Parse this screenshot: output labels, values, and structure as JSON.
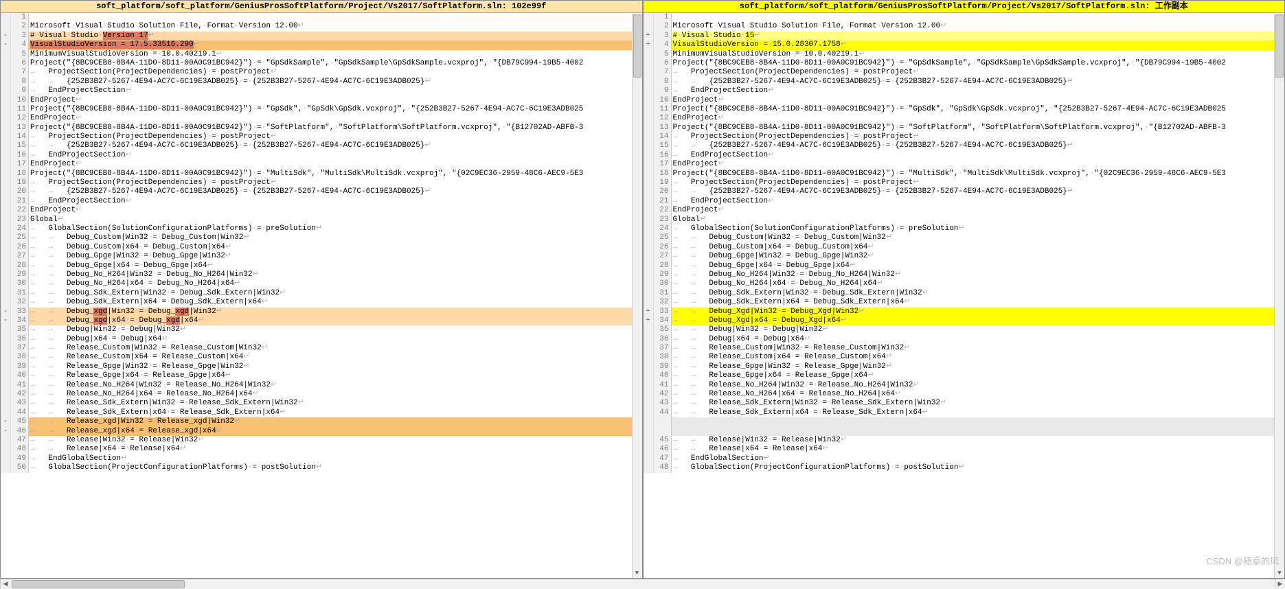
{
  "watermark": "CSDN @随意的风",
  "left": {
    "title": "soft_platform/soft_platform/GeniusProsSoftPlatform/Project/Vs2017/SoftPlatform.sln: 102e99f",
    "rows": [
      {
        "mk": "",
        "ln": "1",
        "text": "",
        "bg": ""
      },
      {
        "mk": "",
        "ln": "2",
        "text": "Microsoft·Visual·Studio·Solution·File,·Format·Version·12.00↩",
        "bg": ""
      },
      {
        "mk": "-",
        "ln": "3",
        "pre": "#·Visual·Studio·",
        "chip": "Version·17",
        "post": "↩",
        "bg": "bg-rm",
        "chipcls": "chip-rm"
      },
      {
        "mk": "-",
        "ln": "4",
        "pre": "",
        "chip": "VisualStudioVersion·=·17.5.33516.290",
        "post": "↩",
        "bg": "bg-rm-strong",
        "chipcls": "chip-rm"
      },
      {
        "mk": "",
        "ln": "5",
        "text": "MinimumVisualStudioVersion·=·10.0.40219.1↩",
        "bg": ""
      },
      {
        "mk": "",
        "ln": "6",
        "text": "Project(\"{8BC9CEB8-8B4A-11D0-8D11-00A0C91BC942}\")·=·\"GpSdkSample\",·\"GpSdkSample\\GpSdkSample.vcxproj\",·\"{DB79C994-19B5-4002",
        "bg": ""
      },
      {
        "mk": "",
        "ln": "7",
        "text": "→   ProjectSection(ProjectDependencies)·=·postProject↩",
        "bg": ""
      },
      {
        "mk": "",
        "ln": "8",
        "text": "→   →   {252B3B27-5267-4E94-AC7C-6C19E3ADB025}·=·{252B3B27-5267-4E94-AC7C-6C19E3ADB025}↩",
        "bg": ""
      },
      {
        "mk": "",
        "ln": "9",
        "text": "→   EndProjectSection↩",
        "bg": ""
      },
      {
        "mk": "",
        "ln": "10",
        "text": "EndProject↩",
        "bg": ""
      },
      {
        "mk": "",
        "ln": "11",
        "text": "Project(\"{8BC9CEB8-8B4A-11D0-8D11-00A0C91BC942}\")·=·\"GpSdk\",·\"GpSdk\\GpSdk.vcxproj\",·\"{252B3B27-5267-4E94-AC7C-6C19E3ADB025",
        "bg": ""
      },
      {
        "mk": "",
        "ln": "12",
        "text": "EndProject↩",
        "bg": ""
      },
      {
        "mk": "",
        "ln": "13",
        "text": "Project(\"{8BC9CEB8-8B4A-11D0-8D11-00A0C91BC942}\")·=·\"SoftPlatform\",·\"SoftPlatform\\SoftPlatform.vcxproj\",·\"{B12702AD-ABFB-3",
        "bg": ""
      },
      {
        "mk": "",
        "ln": "14",
        "text": "→   ProjectSection(ProjectDependencies)·=·postProject↩",
        "bg": ""
      },
      {
        "mk": "",
        "ln": "15",
        "text": "→   →   {252B3B27-5267-4E94-AC7C-6C19E3ADB025}·=·{252B3B27-5267-4E94-AC7C-6C19E3ADB025}↩",
        "bg": ""
      },
      {
        "mk": "",
        "ln": "16",
        "text": "→   EndProjectSection↩",
        "bg": ""
      },
      {
        "mk": "",
        "ln": "17",
        "text": "EndProject↩",
        "bg": ""
      },
      {
        "mk": "",
        "ln": "18",
        "text": "Project(\"{8BC9CEB8-8B4A-11D0-8D11-00A0C91BC942}\")·=·\"MultiSdk\",·\"MultiSdk\\MultiSdk.vcxproj\",·\"{02C9EC36-2959-48C6-AEC9-5E3",
        "bg": ""
      },
      {
        "mk": "",
        "ln": "19",
        "text": "→   ProjectSection(ProjectDependencies)·=·postProject↩",
        "bg": ""
      },
      {
        "mk": "",
        "ln": "20",
        "text": "→   →   {252B3B27-5267-4E94-AC7C-6C19E3ADB025}·=·{252B3B27-5267-4E94-AC7C-6C19E3ADB025}↩",
        "bg": ""
      },
      {
        "mk": "",
        "ln": "21",
        "text": "→   EndProjectSection↩",
        "bg": ""
      },
      {
        "mk": "",
        "ln": "22",
        "text": "EndProject↩",
        "bg": ""
      },
      {
        "mk": "",
        "ln": "23",
        "text": "Global↩",
        "bg": ""
      },
      {
        "mk": "",
        "ln": "24",
        "text": "→   GlobalSection(SolutionConfigurationPlatforms)·=·preSolution↩",
        "bg": ""
      },
      {
        "mk": "",
        "ln": "25",
        "text": "→   →   Debug_Custom|Win32·=·Debug_Custom|Win32↩",
        "bg": ""
      },
      {
        "mk": "",
        "ln": "26",
        "text": "→   →   Debug_Custom|x64·=·Debug_Custom|x64↩",
        "bg": ""
      },
      {
        "mk": "",
        "ln": "27",
        "text": "→   →   Debug_Gpge|Win32·=·Debug_Gpge|Win32↩",
        "bg": ""
      },
      {
        "mk": "",
        "ln": "28",
        "text": "→   →   Debug_Gpge|x64·=·Debug_Gpge|x64↩",
        "bg": ""
      },
      {
        "mk": "",
        "ln": "29",
        "text": "→   →   Debug_No_H264|Win32·=·Debug_No_H264|Win32↩",
        "bg": ""
      },
      {
        "mk": "",
        "ln": "30",
        "text": "→   →   Debug_No_H264|x64·=·Debug_No_H264|x64↩",
        "bg": ""
      },
      {
        "mk": "",
        "ln": "31",
        "text": "→   →   Debug_Sdk_Extern|Win32·=·Debug_Sdk_Extern|Win32↩",
        "bg": ""
      },
      {
        "mk": "",
        "ln": "32",
        "text": "→   →   Debug_Sdk_Extern|x64·=·Debug_Sdk_Extern|x64↩",
        "bg": ""
      },
      {
        "mk": "-",
        "ln": "33",
        "parts": [
          {
            "t": "→   →   Debug_"
          },
          {
            "t": "xgd",
            "c": "chip-rm"
          },
          {
            "t": "|Win32·=·Debug_"
          },
          {
            "t": "xgd",
            "c": "chip-rm"
          },
          {
            "t": "|Win32↩"
          }
        ],
        "bg": "bg-rm"
      },
      {
        "mk": "-",
        "ln": "34",
        "parts": [
          {
            "t": "→   →   Debug_"
          },
          {
            "t": "xgd",
            "c": "chip-rm"
          },
          {
            "t": "|x64·=·Debug_"
          },
          {
            "t": "xgd",
            "c": "chip-rm"
          },
          {
            "t": "|x64↩"
          }
        ],
        "bg": "bg-rm"
      },
      {
        "mk": "",
        "ln": "35",
        "text": "→   →   Debug|Win32·=·Debug|Win32↩",
        "bg": ""
      },
      {
        "mk": "",
        "ln": "36",
        "text": "→   →   Debug|x64·=·Debug|x64↩",
        "bg": ""
      },
      {
        "mk": "",
        "ln": "37",
        "text": "→   →   Release_Custom|Win32·=·Release_Custom|Win32↩",
        "bg": ""
      },
      {
        "mk": "",
        "ln": "38",
        "text": "→   →   Release_Custom|x64·=·Release_Custom|x64↩",
        "bg": ""
      },
      {
        "mk": "",
        "ln": "39",
        "text": "→   →   Release_Gpge|Win32·=·Release_Gpge|Win32↩",
        "bg": ""
      },
      {
        "mk": "",
        "ln": "40",
        "text": "→   →   Release_Gpge|x64·=·Release_Gpge|x64↩",
        "bg": ""
      },
      {
        "mk": "",
        "ln": "41",
        "text": "→   →   Release_No_H264|Win32·=·Release_No_H264|Win32↩",
        "bg": ""
      },
      {
        "mk": "",
        "ln": "42",
        "text": "→   →   Release_No_H264|x64·=·Release_No_H264|x64↩",
        "bg": ""
      },
      {
        "mk": "",
        "ln": "43",
        "text": "→   →   Release_Sdk_Extern|Win32·=·Release_Sdk_Extern|Win32↩",
        "bg": ""
      },
      {
        "mk": "",
        "ln": "44",
        "text": "→   →   Release_Sdk_Extern|x64·=·Release_Sdk_Extern|x64↩",
        "bg": ""
      },
      {
        "mk": "-",
        "ln": "45",
        "text": "→   →   Release_xgd|Win32·=·Release_xgd|Win32↩",
        "bg": "bg-rm-strong"
      },
      {
        "mk": "-",
        "ln": "46",
        "text": "→   →   Release_xgd|x64·=·Release_xgd|x64↩",
        "bg": "bg-rm-strong"
      },
      {
        "mk": "",
        "ln": "47",
        "text": "→   →   Release|Win32·=·Release|Win32↩",
        "bg": ""
      },
      {
        "mk": "",
        "ln": "48",
        "text": "→   →   Release|x64·=·Release|x64↩",
        "bg": ""
      },
      {
        "mk": "",
        "ln": "49",
        "text": "→   EndGlobalSection↩",
        "bg": ""
      },
      {
        "mk": "",
        "ln": "50",
        "text": "→   GlobalSection(ProjectConfigurationPlatforms)·=·postSolution↩",
        "bg": ""
      }
    ]
  },
  "right": {
    "title": "soft_platform/soft_platform/GeniusProsSoftPlatform/Project/Vs2017/SoftPlatform.sln: 工作副本",
    "rows": [
      {
        "mk": "",
        "ln": "1",
        "text": "",
        "bg": ""
      },
      {
        "mk": "",
        "ln": "2",
        "text": "Microsoft·Visual·Studio·Solution·File,·Format·Version·12.00↩",
        "bg": ""
      },
      {
        "mk": "+",
        "ln": "3",
        "pre": "#·Visual·Studio·",
        "chip": "15",
        "post": "↩",
        "bg": "bg-add",
        "chipcls": "chip-add"
      },
      {
        "mk": "+",
        "ln": "4",
        "pre": "",
        "chip": "VisualStudioVersion·=·15.0.28307.1758",
        "post": "↩",
        "bg": "bg-add-strong",
        "chipcls": "chip-add"
      },
      {
        "mk": "",
        "ln": "5",
        "text": "MinimumVisualStudioVersion·=·10.0.40219.1↩",
        "bg": ""
      },
      {
        "mk": "",
        "ln": "6",
        "text": "Project(\"{8BC9CEB8-8B4A-11D0-8D11-00A0C91BC942}\")·=·\"GpSdkSample\",·\"GpSdkSample\\GpSdkSample.vcxproj\",·\"{DB79C994-19B5-4002",
        "bg": ""
      },
      {
        "mk": "",
        "ln": "7",
        "text": "→   ProjectSection(ProjectDependencies)·=·postProject↩",
        "bg": ""
      },
      {
        "mk": "",
        "ln": "8",
        "text": "→   →   {252B3B27-5267-4E94-AC7C-6C19E3ADB025}·=·{252B3B27-5267-4E94-AC7C-6C19E3ADB025}↩",
        "bg": ""
      },
      {
        "mk": "",
        "ln": "9",
        "text": "→   EndProjectSection↩",
        "bg": ""
      },
      {
        "mk": "",
        "ln": "10",
        "text": "EndProject↩",
        "bg": ""
      },
      {
        "mk": "",
        "ln": "11",
        "text": "Project(\"{8BC9CEB8-8B4A-11D0-8D11-00A0C91BC942}\")·=·\"GpSdk\",·\"GpSdk\\GpSdk.vcxproj\",·\"{252B3B27-5267-4E94-AC7C-6C19E3ADB025",
        "bg": ""
      },
      {
        "mk": "",
        "ln": "12",
        "text": "EndProject↩",
        "bg": ""
      },
      {
        "mk": "",
        "ln": "13",
        "text": "Project(\"{8BC9CEB8-8B4A-11D0-8D11-00A0C91BC942}\")·=·\"SoftPlatform\",·\"SoftPlatform\\SoftPlatform.vcxproj\",·\"{B12702AD-ABFB-3",
        "bg": ""
      },
      {
        "mk": "",
        "ln": "14",
        "text": "→   ProjectSection(ProjectDependencies)·=·postProject↩",
        "bg": ""
      },
      {
        "mk": "",
        "ln": "15",
        "text": "→   →   {252B3B27-5267-4E94-AC7C-6C19E3ADB025}·=·{252B3B27-5267-4E94-AC7C-6C19E3ADB025}↩",
        "bg": ""
      },
      {
        "mk": "",
        "ln": "16",
        "text": "→   EndProjectSection↩",
        "bg": ""
      },
      {
        "mk": "",
        "ln": "17",
        "text": "EndProject↩",
        "bg": ""
      },
      {
        "mk": "",
        "ln": "18",
        "text": "Project(\"{8BC9CEB8-8B4A-11D0-8D11-00A0C91BC942}\")·=·\"MultiSdk\",·\"MultiSdk\\MultiSdk.vcxproj\",·\"{02C9EC36-2959-48C6-AEC9-5E3",
        "bg": ""
      },
      {
        "mk": "",
        "ln": "19",
        "text": "→   ProjectSection(ProjectDependencies)·=·postProject↩",
        "bg": ""
      },
      {
        "mk": "",
        "ln": "20",
        "text": "→   →   {252B3B27-5267-4E94-AC7C-6C19E3ADB025}·=·{252B3B27-5267-4E94-AC7C-6C19E3ADB025}↩",
        "bg": ""
      },
      {
        "mk": "",
        "ln": "21",
        "text": "→   EndProjectSection↩",
        "bg": ""
      },
      {
        "mk": "",
        "ln": "22",
        "text": "EndProject↩",
        "bg": ""
      },
      {
        "mk": "",
        "ln": "23",
        "text": "Global↩",
        "bg": ""
      },
      {
        "mk": "",
        "ln": "24",
        "text": "→   GlobalSection(SolutionConfigurationPlatforms)·=·preSolution↩",
        "bg": ""
      },
      {
        "mk": "",
        "ln": "25",
        "text": "→   →   Debug_Custom|Win32·=·Debug_Custom|Win32↩",
        "bg": ""
      },
      {
        "mk": "",
        "ln": "26",
        "text": "→   →   Debug_Custom|x64·=·Debug_Custom|x64↩",
        "bg": ""
      },
      {
        "mk": "",
        "ln": "27",
        "text": "→   →   Debug_Gpge|Win32·=·Debug_Gpge|Win32↩",
        "bg": ""
      },
      {
        "mk": "",
        "ln": "28",
        "text": "→   →   Debug_Gpge|x64·=·Debug_Gpge|x64↩",
        "bg": ""
      },
      {
        "mk": "",
        "ln": "29",
        "text": "→   →   Debug_No_H264|Win32·=·Debug_No_H264|Win32↩",
        "bg": ""
      },
      {
        "mk": "",
        "ln": "30",
        "text": "→   →   Debug_No_H264|x64·=·Debug_No_H264|x64↩",
        "bg": ""
      },
      {
        "mk": "",
        "ln": "31",
        "text": "→   →   Debug_Sdk_Extern|Win32·=·Debug_Sdk_Extern|Win32↩",
        "bg": ""
      },
      {
        "mk": "",
        "ln": "32",
        "text": "→   →   Debug_Sdk_Extern|x64·=·Debug_Sdk_Extern|x64↩",
        "bg": ""
      },
      {
        "mk": "+",
        "ln": "33",
        "parts": [
          {
            "t": "→   →   Debug_"
          },
          {
            "t": "Xgd",
            "c": "chip-add"
          },
          {
            "t": "|Win32·=·Debug_"
          },
          {
            "t": "Xgd",
            "c": "chip-add"
          },
          {
            "t": "|Win32↩"
          }
        ],
        "bg": "bg-add-strong"
      },
      {
        "mk": "+",
        "ln": "34",
        "parts": [
          {
            "t": "→   →   Debug_"
          },
          {
            "t": "Xgd",
            "c": "chip-add"
          },
          {
            "t": "|x64·=·Debug_"
          },
          {
            "t": "Xgd",
            "c": "chip-add"
          },
          {
            "t": "|x64↩"
          }
        ],
        "bg": "bg-add-strong"
      },
      {
        "mk": "",
        "ln": "35",
        "text": "→   →   Debug|Win32·=·Debug|Win32↩",
        "bg": ""
      },
      {
        "mk": "",
        "ln": "36",
        "text": "→   →   Debug|x64·=·Debug|x64↩",
        "bg": ""
      },
      {
        "mk": "",
        "ln": "37",
        "text": "→   →   Release_Custom|Win32·=·Release_Custom|Win32↩",
        "bg": ""
      },
      {
        "mk": "",
        "ln": "38",
        "text": "→   →   Release_Custom|x64·=·Release_Custom|x64↩",
        "bg": ""
      },
      {
        "mk": "",
        "ln": "39",
        "text": "→   →   Release_Gpge|Win32·=·Release_Gpge|Win32↩",
        "bg": ""
      },
      {
        "mk": "",
        "ln": "40",
        "text": "→   →   Release_Gpge|x64·=·Release_Gpge|x64↩",
        "bg": ""
      },
      {
        "mk": "",
        "ln": "41",
        "text": "→   →   Release_No_H264|Win32·=·Release_No_H264|Win32↩",
        "bg": ""
      },
      {
        "mk": "",
        "ln": "42",
        "text": "→   →   Release_No_H264|x64·=·Release_No_H264|x64↩",
        "bg": ""
      },
      {
        "mk": "",
        "ln": "43",
        "text": "→   →   Release_Sdk_Extern|Win32·=·Release_Sdk_Extern|Win32↩",
        "bg": ""
      },
      {
        "mk": "",
        "ln": "44",
        "text": "→   →   Release_Sdk_Extern|x64·=·Release_Sdk_Extern|x64↩",
        "bg": ""
      },
      {
        "mk": "",
        "ln": "",
        "text": "",
        "bg": "bg-miss"
      },
      {
        "mk": "",
        "ln": "",
        "text": "",
        "bg": "bg-miss"
      },
      {
        "mk": "",
        "ln": "45",
        "text": "→   →   Release|Win32·=·Release|Win32↩",
        "bg": ""
      },
      {
        "mk": "",
        "ln": "46",
        "text": "→   →   Release|x64·=·Release|x64↩",
        "bg": ""
      },
      {
        "mk": "",
        "ln": "47",
        "text": "→   EndGlobalSection↩",
        "bg": ""
      },
      {
        "mk": "",
        "ln": "48",
        "text": "→   GlobalSection(ProjectConfigurationPlatforms)·=·postSolution↩",
        "bg": ""
      }
    ]
  }
}
